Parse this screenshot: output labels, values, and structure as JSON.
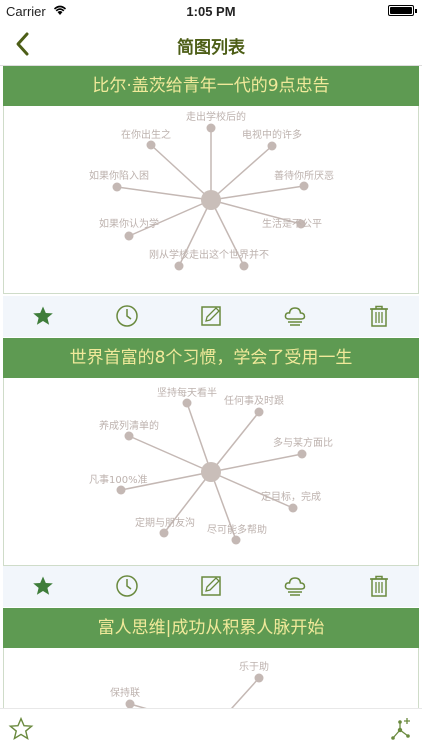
{
  "status_bar": {
    "carrier": "Carrier",
    "time": "1:05 PM"
  },
  "nav": {
    "title": "简图列表",
    "back_icon": "chevron-left-icon"
  },
  "colors": {
    "header_bg": "#5e9a52",
    "header_text": "#f0e99a",
    "nav_title": "#4d5e17",
    "star": "#3f7d3a",
    "toolbar_icons": "#6a8a3e",
    "toolbar_bg": "#f2f6fb",
    "mindmap": "#c4b8b4"
  },
  "cards": [
    {
      "title": "比尔·盖茨给青年一代的9点忠告",
      "nodes": [
        "走出学校后的",
        "电视中的许多",
        "善待你所厌恶",
        "生活是不公平",
        "刚从学校走出这个世界并不",
        "如果你认为学",
        "如果你陷入困",
        "在你出生之"
      ]
    },
    {
      "title": "世界首富的8个习惯，学会了受用一生",
      "nodes": [
        "坚持每天看半",
        "任何事及时跟",
        "多与某方面比",
        "定目标，完成",
        "尽可能多帮助",
        "定期与朋友沟",
        "凡事100%准",
        "养成列清单的"
      ]
    },
    {
      "title": "富人思维|成功从积累人脉开始",
      "nodes": [
        "乐于助",
        "保持联"
      ]
    }
  ],
  "toolbar": {
    "icons": [
      "star-icon",
      "clock-icon",
      "edit-icon",
      "cloud-upload-icon",
      "trash-icon"
    ]
  },
  "bottom_bar": {
    "left_icon": "star-outline-icon",
    "right_icon": "add-node-icon"
  }
}
